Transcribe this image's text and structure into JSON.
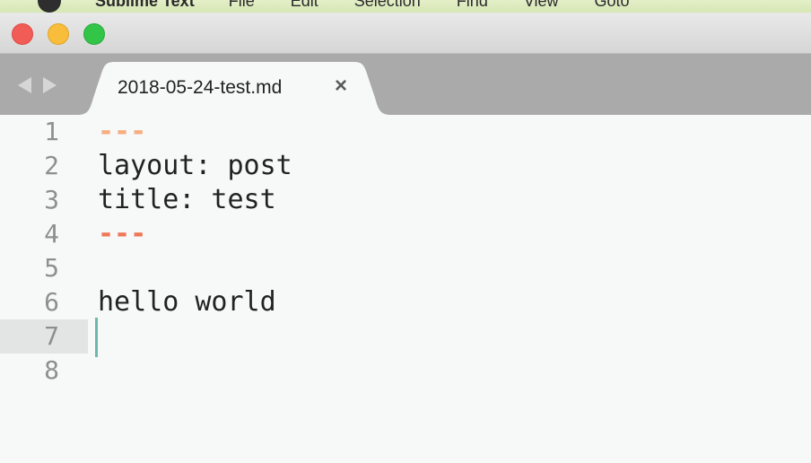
{
  "menubar": {
    "app_name": "Sublime Text",
    "items": [
      "File",
      "Edit",
      "Selection",
      "Find",
      "View",
      "Goto"
    ]
  },
  "window": {
    "controls": [
      "close",
      "minimize",
      "maximize"
    ]
  },
  "tabbar": {
    "nav_back_icon": "triangle-left",
    "nav_forward_icon": "triangle-right",
    "active_tab": {
      "title": "2018-05-24-test.md",
      "close_symbol": "×"
    }
  },
  "editor": {
    "active_line": 7,
    "lines": [
      {
        "number": "1",
        "text": "---"
      },
      {
        "number": "2",
        "text": "layout: post"
      },
      {
        "number": "3",
        "text": "title: test"
      },
      {
        "number": "4",
        "text": "---"
      },
      {
        "number": "5",
        "text": ""
      },
      {
        "number": "6",
        "text": "hello world"
      },
      {
        "number": "7",
        "text": ""
      },
      {
        "number": "8",
        "text": ""
      }
    ]
  },
  "colors": {
    "frontmatter_open": "#f6ad80",
    "frontmatter_close": "#ef7859",
    "cursor": "#6fb8ad",
    "gutter_text": "#8f8f8f",
    "background": "#f7f9f8"
  }
}
